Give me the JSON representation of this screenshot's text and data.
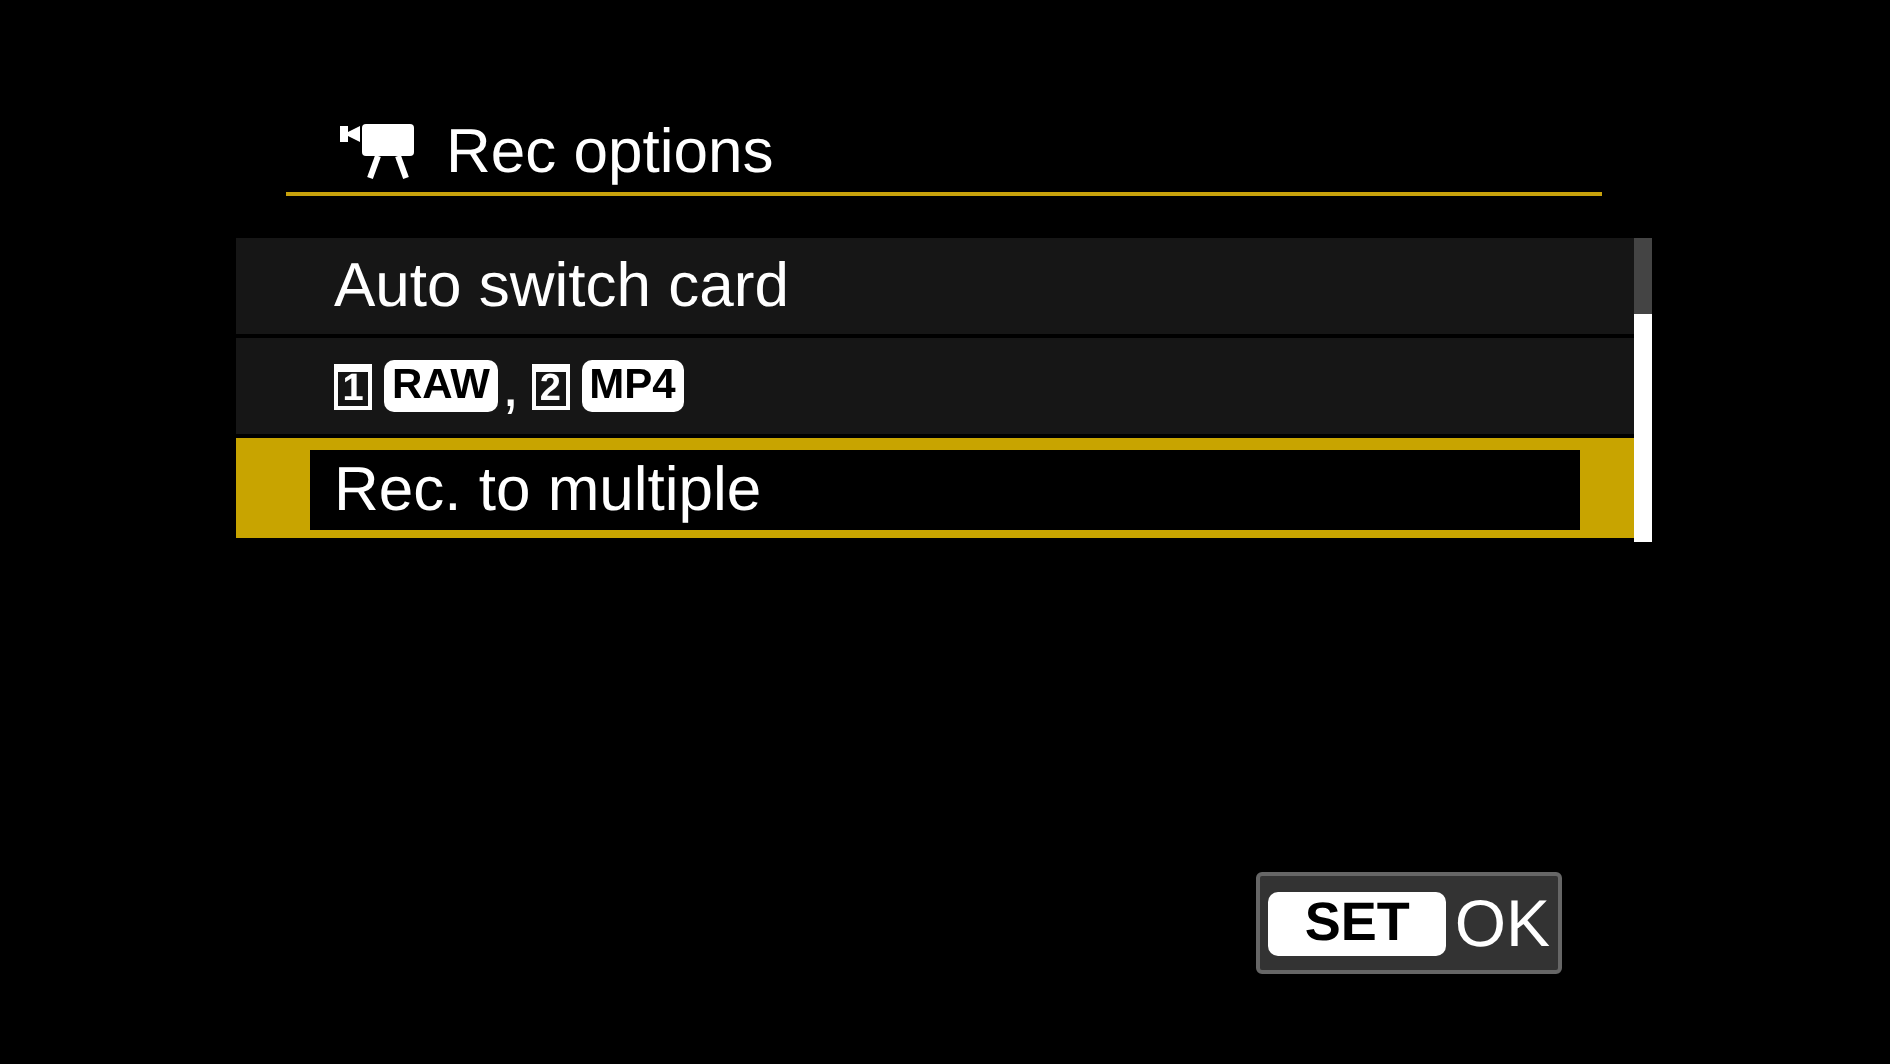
{
  "title": "Rec options",
  "items": [
    {
      "kind": "text",
      "label": "Auto switch card",
      "selected": false
    },
    {
      "kind": "cards",
      "selected": false,
      "parts": [
        {
          "kind": "card",
          "text": "1"
        },
        {
          "kind": "badge",
          "text": "RAW"
        },
        {
          "kind": "text",
          "text": ","
        },
        {
          "kind": "card",
          "text": "2"
        },
        {
          "kind": "badge",
          "text": "MP4"
        }
      ]
    },
    {
      "kind": "text",
      "label": "Rec. to multiple",
      "selected": true
    }
  ],
  "ok_button": {
    "key": "SET",
    "label": "OK"
  }
}
